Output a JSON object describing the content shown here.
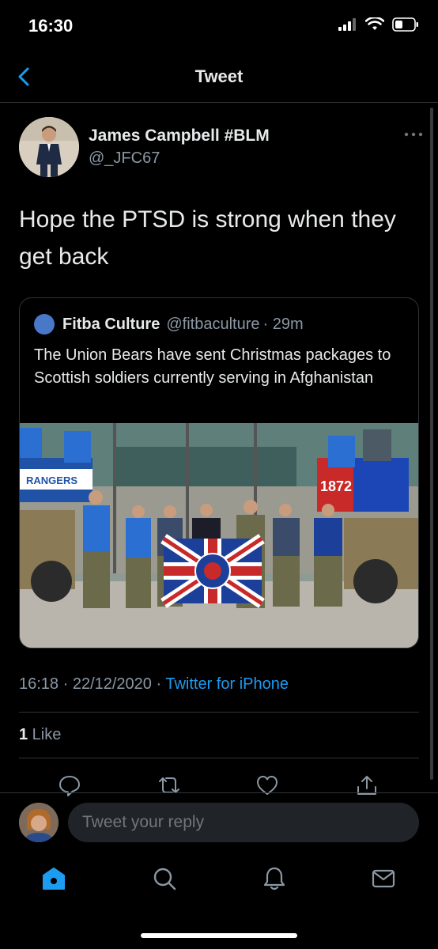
{
  "status_bar": {
    "time": "16:30"
  },
  "nav": {
    "title": "Tweet"
  },
  "tweet": {
    "author_name": "James Campbell #BLM",
    "author_handle": "@_JFC67",
    "text": "Hope the PTSD is strong when they get back",
    "quoted": {
      "author_name": "Fitba Culture",
      "author_handle": "@fitbaculture",
      "time_ago": "· 29m",
      "text": "The Union Bears have sent Christmas packages to Scottish soldiers currently serving in Afghanistan",
      "image_banner_text": "RANGERS",
      "image_flag_text": "1872"
    },
    "timestamp": "16:18 · 22/12/2020 · ",
    "source": "Twitter for iPhone",
    "like_count": "1",
    "like_label": " Like"
  },
  "reply": {
    "placeholder": "Tweet your reply"
  },
  "icons": {
    "back": "chevron-left-icon",
    "more": "more-dots-icon",
    "reply": "reply-icon",
    "retweet": "retweet-icon",
    "like": "heart-icon",
    "share": "share-icon",
    "home": "home-icon",
    "search": "search-icon",
    "notifications": "bell-icon",
    "messages": "mail-icon"
  },
  "colors": {
    "accent": "#1d9bf0",
    "background": "#000000",
    "secondary_text": "#8b98a5"
  }
}
